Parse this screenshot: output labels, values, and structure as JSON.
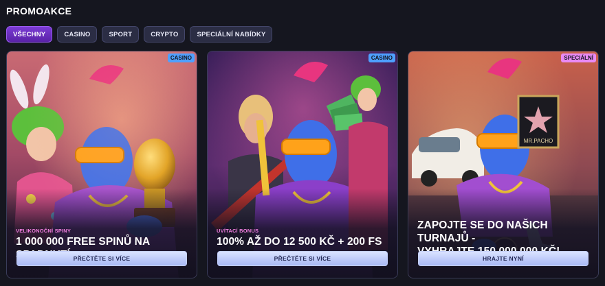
{
  "page": {
    "title": "PROMOAKCE"
  },
  "filters": [
    {
      "label": "VŠECHNY",
      "active": true
    },
    {
      "label": "CASINO",
      "active": false
    },
    {
      "label": "SPORT",
      "active": false
    },
    {
      "label": "CRYPTO",
      "active": false
    },
    {
      "label": "SPECIÁLNÍ NABÍDKY",
      "active": false
    }
  ],
  "cards": [
    {
      "badge": "CASINO",
      "badge_color": "#4ea0ff",
      "subtitle": "VELIKONOČNÍ SPINY",
      "headline": "1 000 000 FREE SPINŮ NA SPADNUTÍ",
      "cta": "PŘEČTĚTE SI VÍCE"
    },
    {
      "badge": "CASINO",
      "badge_color": "#4ea0ff",
      "subtitle": "UVÍTACÍ BONUS",
      "headline": "100% AŽ DO 12 500 KČ + 200 FS",
      "cta": "PŘEČTĚTE SI VÍCE"
    },
    {
      "badge": "SPECIÁLNÍ",
      "badge_color": "#e98af5",
      "subtitle": "",
      "headline_line1": "ZAPOJTE SE DO NAŠICH TURNAJŮ -",
      "headline_line2": "VYHRAJTE 150 000 000 KČ!",
      "cta": "HRAJTE NYNÍ",
      "sign_text": "MR.PACHO"
    }
  ],
  "colors": {
    "background": "#15161f",
    "accent_purple": "#7b3bd4",
    "subtitle_pink": "#f17fe0",
    "cta_blue": "#c5d1ff"
  }
}
